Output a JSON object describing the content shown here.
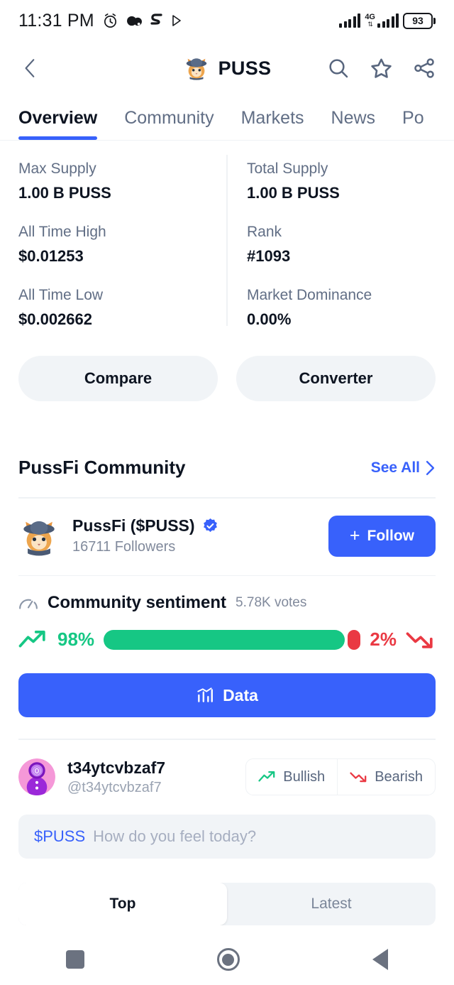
{
  "status_bar": {
    "time": "11:31 PM",
    "icons": [
      "alarm-icon",
      "app-icon-1",
      "app-icon-2",
      "play-icon"
    ],
    "network_type": "4G",
    "battery_percent": "93"
  },
  "header": {
    "back_icon": "chevron-left-icon",
    "title": "PUSS",
    "avatar": "cat-avatar",
    "actions": [
      "search-icon",
      "star-icon",
      "share-icon"
    ]
  },
  "tabs": [
    {
      "label": "Overview",
      "active": true
    },
    {
      "label": "Community",
      "active": false
    },
    {
      "label": "Markets",
      "active": false
    },
    {
      "label": "News",
      "active": false
    },
    {
      "label": "Po",
      "active": false
    }
  ],
  "stats": {
    "left": [
      {
        "label": "Max Supply",
        "value": "1.00 B PUSS"
      },
      {
        "label": "All Time High",
        "value": "$0.01253"
      },
      {
        "label": "All Time Low",
        "value": "$0.002662"
      }
    ],
    "right": [
      {
        "label": "Total Supply",
        "value": "1.00 B PUSS"
      },
      {
        "label": "Rank",
        "value": "#1093"
      },
      {
        "label": "Market Dominance",
        "value": "0.00%"
      }
    ]
  },
  "action_pills": [
    {
      "label": "Compare"
    },
    {
      "label": "Converter"
    }
  ],
  "community": {
    "section_title": "PussFi Community",
    "see_all_label": "See All",
    "profile": {
      "name": "PussFi ($PUSS)",
      "verified": true,
      "followers": "16711 Followers",
      "follow_label": "Follow",
      "plus": "+"
    },
    "sentiment": {
      "title": "Community sentiment",
      "votes": "5.78K votes",
      "bullish_pct": "98%",
      "bearish_pct": "2%",
      "bullish_value": 98,
      "bearish_value": 2,
      "bullish_color": "#16c784",
      "bearish_color": "#ea3943"
    },
    "data_button": {
      "label": "Data",
      "icon": "chart-icon",
      "color": "#3861fb"
    }
  },
  "post_composer": {
    "user": {
      "name": "t34ytcvbzaf7",
      "handle": "@t34ytcvbzaf7"
    },
    "vote_buttons": [
      {
        "label": "Bullish",
        "icon": "trend-up-icon",
        "color": "#16c784"
      },
      {
        "label": "Bearish",
        "icon": "trend-down-icon",
        "color": "#ea3943"
      }
    ],
    "ticker": "$PUSS",
    "placeholder": "How do you feel today?"
  },
  "feed_filter": [
    {
      "label": "Top",
      "active": true
    },
    {
      "label": "Latest",
      "active": false
    }
  ],
  "nav_bar": {
    "items": [
      "recents-square-icon",
      "home-circle-icon",
      "back-triangle-icon"
    ]
  }
}
